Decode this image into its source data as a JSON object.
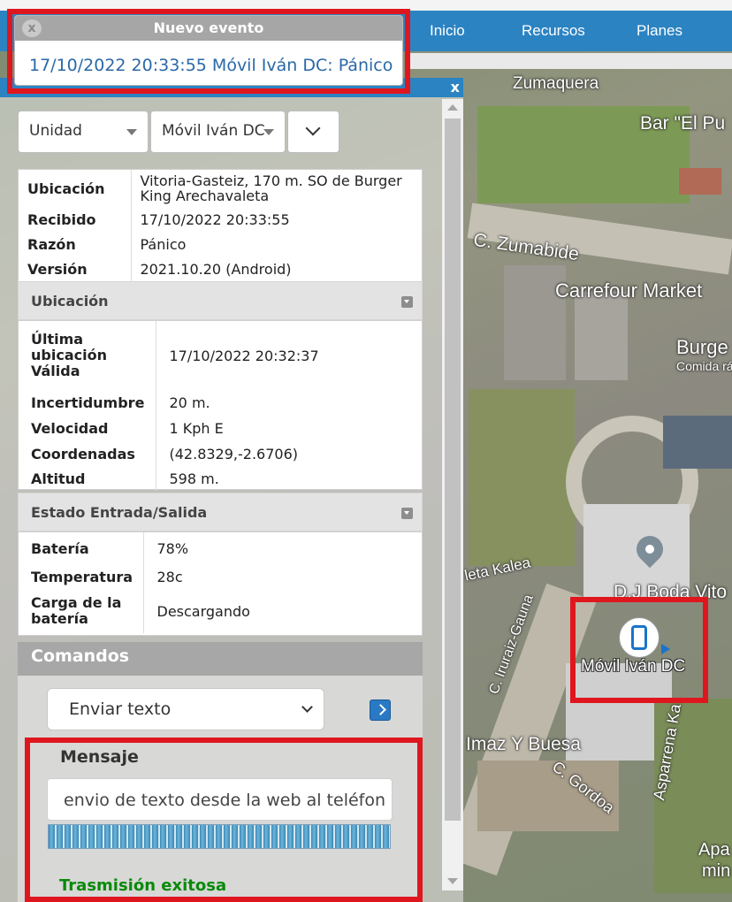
{
  "nav": {
    "items": [
      "Inicio",
      "Recursos",
      "Planes"
    ]
  },
  "popup": {
    "title": "Nuevo evento",
    "close": "x",
    "text": "17/10/2022 20:33:55  Móvil Iván DC: Pánico"
  },
  "panel": {
    "close": "x",
    "filter_type": "Unidad",
    "filter_unit": "Móvil Iván DC",
    "summary": [
      {
        "key": "Ubicación",
        "value": "Vitoria-Gasteiz, 170 m. SO de Burger King Arechavaleta"
      },
      {
        "key": "Recibido",
        "value": "17/10/2022 20:33:55"
      },
      {
        "key": "Razón",
        "value": "Pánico"
      },
      {
        "key": "Versión",
        "value": "2021.10.20 (Android)"
      }
    ],
    "location_section": {
      "title": "Ubicación",
      "rows": [
        {
          "key": "Última ubicación Válida",
          "value": "17/10/2022 20:32:37"
        },
        {
          "key": "Incertidumbre",
          "value": "20 m."
        },
        {
          "key": "Velocidad",
          "value": "1 Kph E"
        },
        {
          "key": "Coordenadas",
          "value": "(42.8329,-2.6706)"
        },
        {
          "key": "Altitud",
          "value": "598 m."
        }
      ]
    },
    "io_section": {
      "title": "Estado Entrada/Salida",
      "rows": [
        {
          "key": "Batería",
          "value": "78%"
        },
        {
          "key": "Temperatura",
          "value": "28c"
        },
        {
          "key": "Carga de la batería",
          "value": "Descargando"
        }
      ]
    },
    "commands": {
      "title": "Comandos",
      "selected": "Enviar texto",
      "message_label": "Mensaje",
      "message_value": "envio de texto desde la web al teléfon",
      "status": "Trasmisión exitosa"
    }
  },
  "map": {
    "labels": [
      "Zumaquera",
      "Bar \"El Pu",
      "C. Zumabide",
      "Carrefour Market",
      "Burge",
      "Comida ráp",
      "D.J Boda Vito",
      "leta Kalea",
      "C. Iruraiz-Gauna",
      "Imaz Y Buesa",
      "C. Gordoa",
      "Asparrena Ka",
      "Apa",
      "min"
    ],
    "marker_label": "Móvil Iván DC"
  },
  "colors": {
    "nav_blue": "#2b83c2",
    "highlight_red": "#e0161e",
    "success_green": "#0a8a0a",
    "link_blue": "#2a68a8"
  }
}
